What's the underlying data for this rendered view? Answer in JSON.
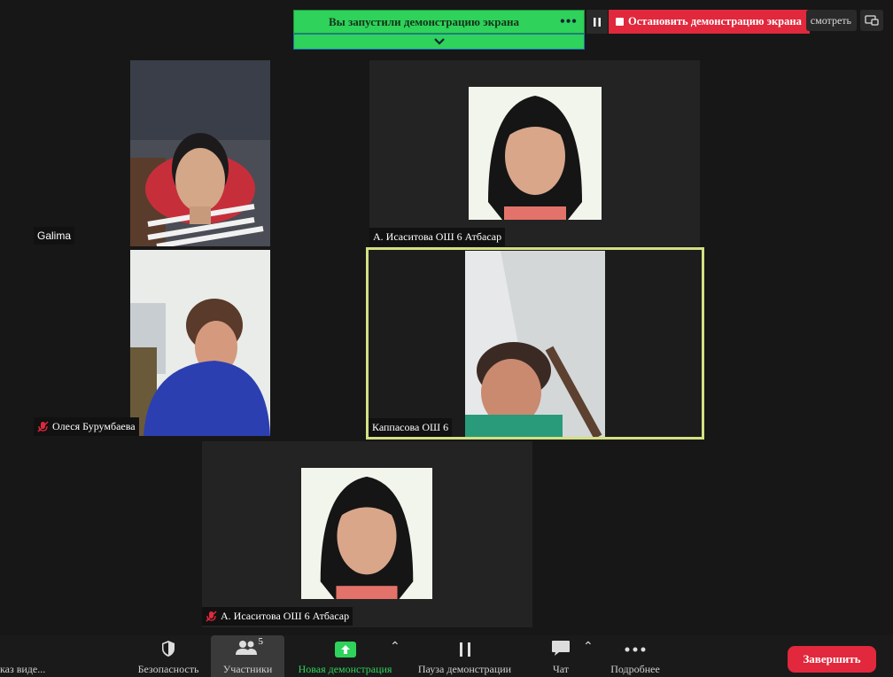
{
  "share_bar": {
    "banner_text": "Вы запустили демонстрацию экрана",
    "more_label": "•••",
    "stop_label": "Остановить демонстрацию экрана",
    "view_label": "смотреть"
  },
  "participants": [
    {
      "name": "Galima"
    },
    {
      "name": "А. Исаситова ОШ 6 Атбасар"
    },
    {
      "name": "Олеся Бурумбаева",
      "muted": true
    },
    {
      "name": "Каппасова ОШ 6",
      "active_speaker": true
    },
    {
      "name": "А. Исаситова ОШ 6 Атбасар",
      "muted": true
    }
  ],
  "toolbar": {
    "video_label": "каз виде...",
    "security_label": "Безопасность",
    "participants_label": "Участники",
    "participants_count": "5",
    "new_share_label": "Новая демонстрация",
    "pause_share_label": "Пауза демонстрации",
    "chat_label": "Чат",
    "more_label": "Подробнее",
    "end_label": "Завершить"
  },
  "colors": {
    "share_green": "#2fd25a",
    "stop_red": "#e1283c",
    "speaker_border": "#d4e083",
    "new_share_green": "#2fd25a"
  }
}
